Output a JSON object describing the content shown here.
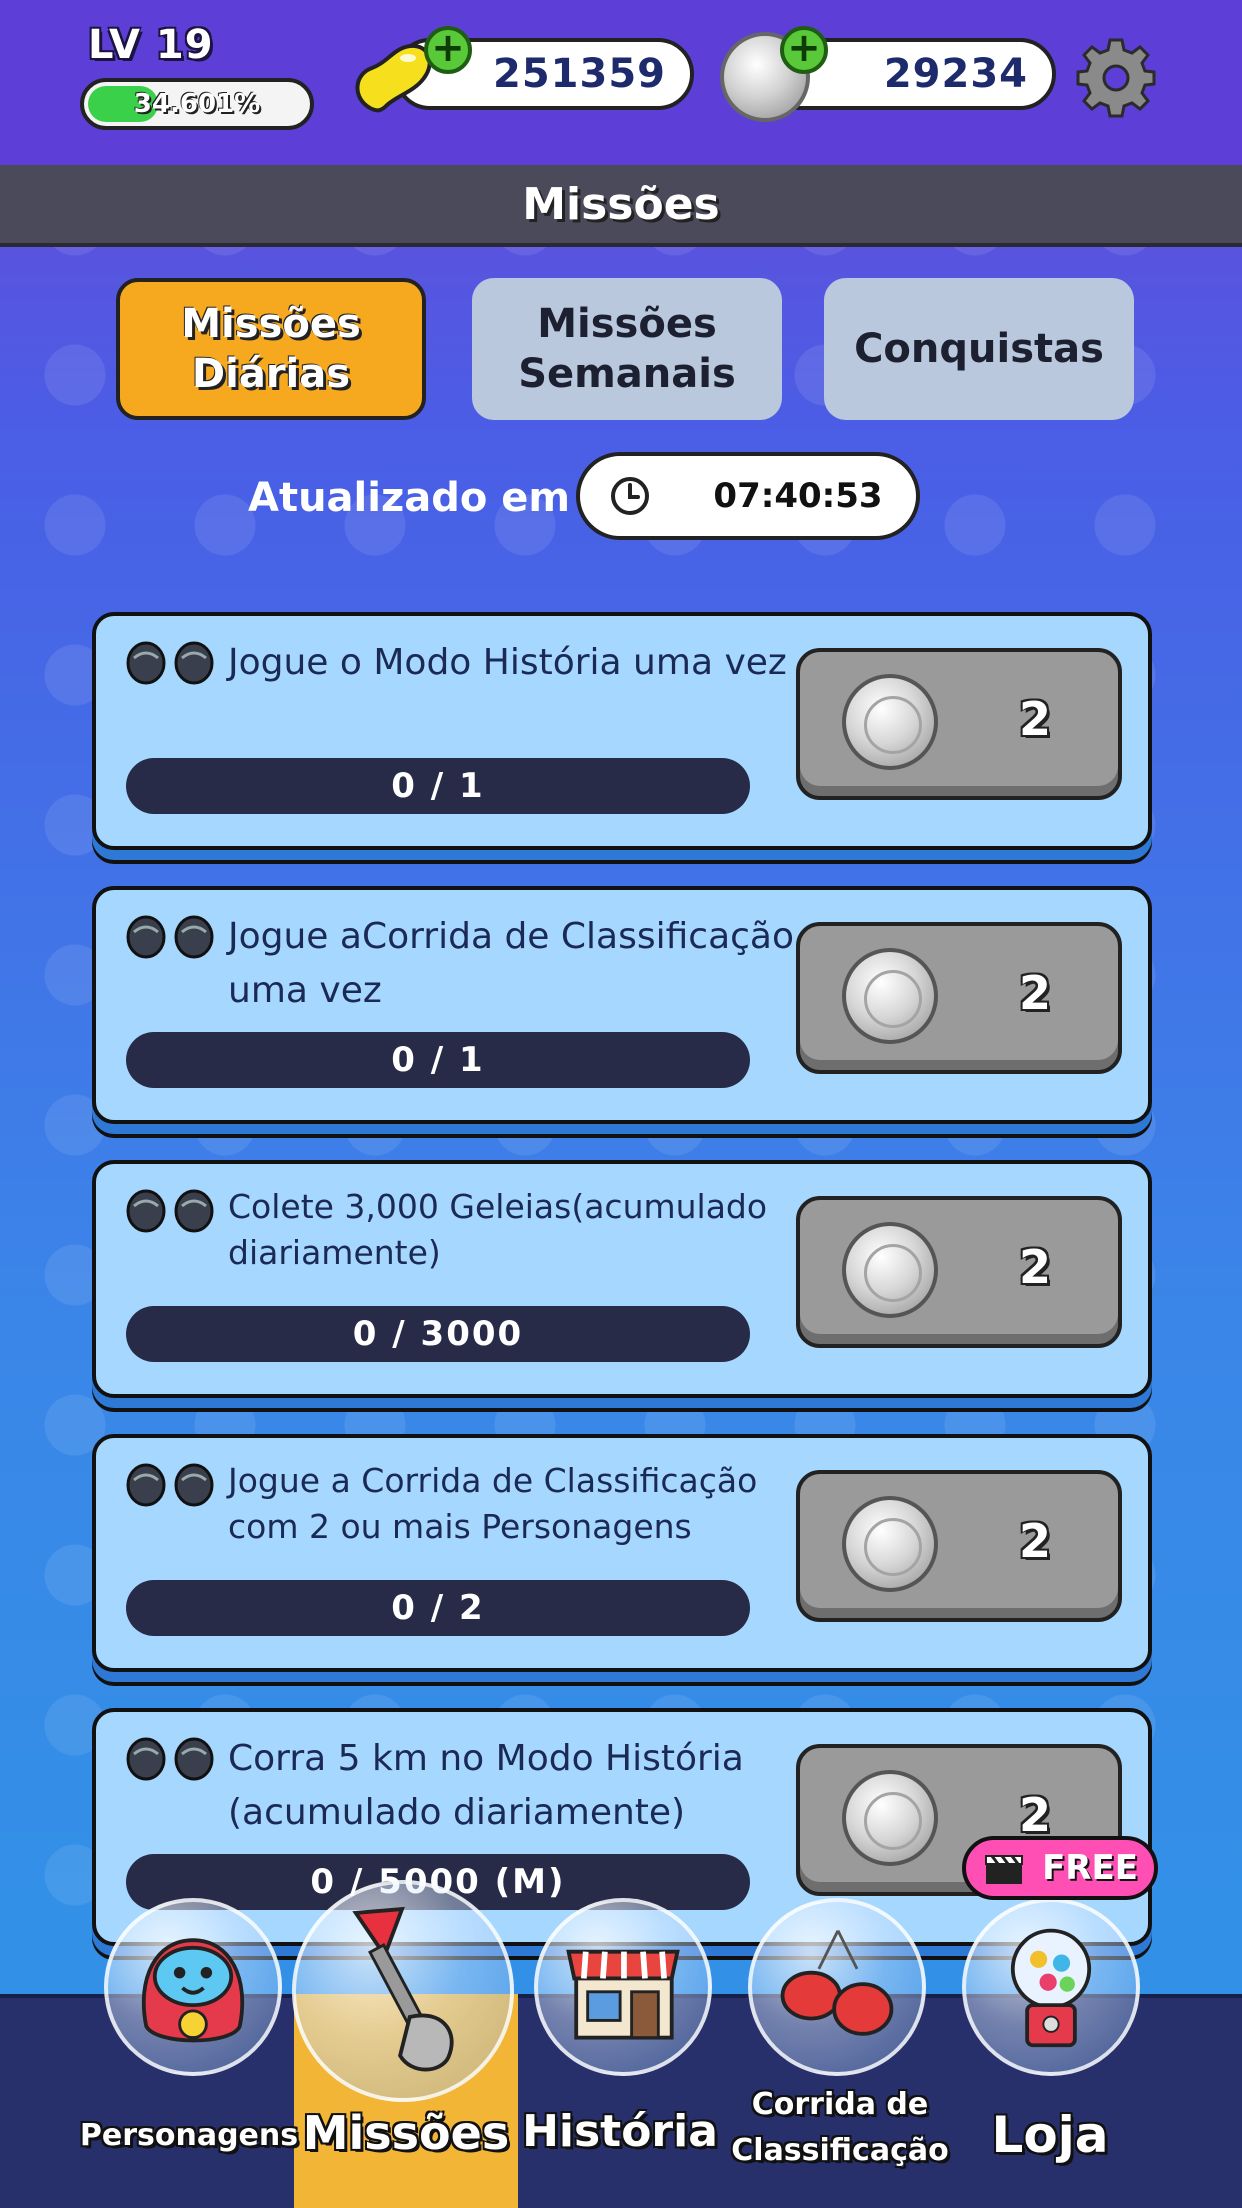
{
  "header": {
    "level": "LV 19",
    "xp_percent_text": "34.601%",
    "xp_fraction": 0.34601,
    "jelly_count": "251359",
    "coin_count": "29234"
  },
  "title": "Missões",
  "tabs": [
    {
      "label": "Missões Diárias",
      "active": true
    },
    {
      "label": "Missões Semanais",
      "active": false
    },
    {
      "label": "Conquistas",
      "active": false
    }
  ],
  "refresh": {
    "label": "Atualizado em",
    "timer": "07:40:53"
  },
  "missions": [
    {
      "text": "Jogue o Modo História uma vez",
      "progress": "0 / 1",
      "reward": "2"
    },
    {
      "text": "Jogue aCorrida de Classificação uma vez",
      "progress": "0 / 1",
      "reward": "2"
    },
    {
      "text": "Colete 3,000 Geleias(acumulado diariamente)",
      "progress": "0 / 3000",
      "reward": "2"
    },
    {
      "text": "Jogue a Corrida de Classificação com 2 ou mais Personagens",
      "progress": "0 / 2",
      "reward": "2"
    },
    {
      "text": "Corra 5 km no Modo História (acumulado diariamente)",
      "progress": "0 / 5000 (M)",
      "reward": "2"
    }
  ],
  "badge_free": "FREE",
  "nav": [
    {
      "label": "Personagens",
      "icon": "character-icon"
    },
    {
      "label": "Missões",
      "icon": "shovel-icon",
      "selected": true
    },
    {
      "label": "História",
      "icon": "shop-building-icon"
    },
    {
      "label": "Corrida de Classificação",
      "icon": "boxing-gloves-icon"
    },
    {
      "label": "Loja",
      "icon": "gumball-machine-icon"
    }
  ],
  "colors": {
    "tab_active": "#f6a81f",
    "mission_card": "#a6d7ff",
    "progress_bar": "#272b48",
    "nav_selected": "#f2b535"
  }
}
